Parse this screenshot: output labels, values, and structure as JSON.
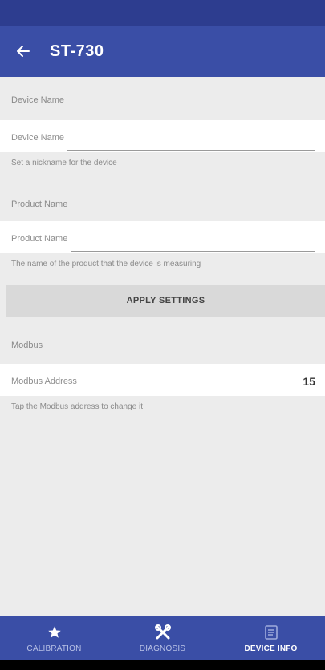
{
  "app_bar": {
    "title": "ST-730"
  },
  "sections": {
    "device_name": {
      "header": "Device Name",
      "field_label": "Device Name",
      "hint": "Set a nickname for the device"
    },
    "product_name": {
      "header": "Product Name",
      "field_label": "Product Name",
      "hint": "The name of the product that the device is measuring"
    },
    "apply_button": "APPLY SETTINGS",
    "modbus": {
      "header": "Modbus",
      "field_label": "Modbus Address",
      "value": "15",
      "hint": "Tap the Modbus address to change it"
    }
  },
  "bottom_nav": {
    "items": [
      {
        "label": "CALIBRATION",
        "icon": "star-icon",
        "active": false
      },
      {
        "label": "DIAGNOSIS",
        "icon": "tools-icon",
        "active": false
      },
      {
        "label": "DEVICE INFO",
        "icon": "device-info-icon",
        "active": true
      }
    ]
  },
  "colors": {
    "primary": "#3a4ea6",
    "status_bar": "#2d3d8f",
    "background": "#ececec",
    "button": "#d9d9d9"
  }
}
